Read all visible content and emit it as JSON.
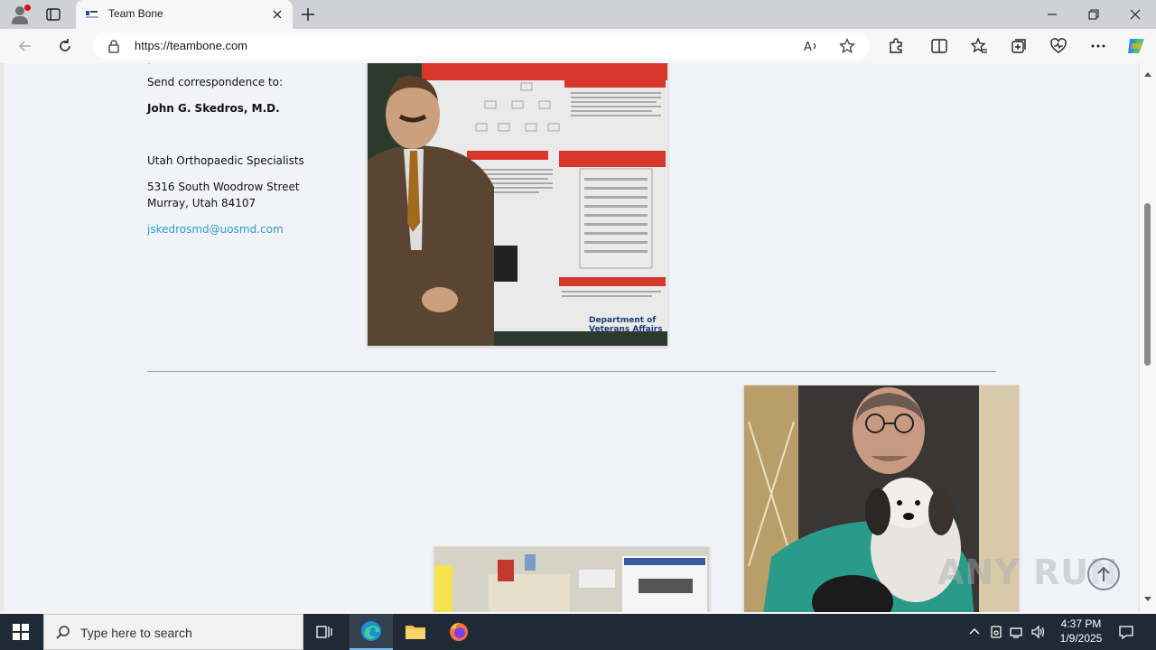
{
  "browser": {
    "tab_title": "Team Bone",
    "url": "https://teambone.com"
  },
  "page": {
    "send_label": "Send correspondence to:",
    "doctor_name": "John G. Skedros, M.D.",
    "org_name": "Utah Orthopaedic Specialists",
    "street": "5316 South Woodrow Street",
    "city": "Murray, Utah 84107",
    "email": "jskedrosmd@uosmd.com"
  },
  "photos": {
    "poster_photo_alt": "Man standing in front of a research poster (Department of Veterans Affairs)",
    "dog_photo_alt": "Man in scrubs with a sheepdog",
    "office_photo_alt": "Office with posters"
  },
  "watermark": "ANY RUN",
  "taskbar": {
    "search_placeholder": "Type here to search",
    "time": "4:37 PM",
    "date": "1/9/2025"
  },
  "colors": {
    "link": "#2a9ec2",
    "taskbar": "#1f2a36",
    "page_bg": "#f2f3f9"
  }
}
